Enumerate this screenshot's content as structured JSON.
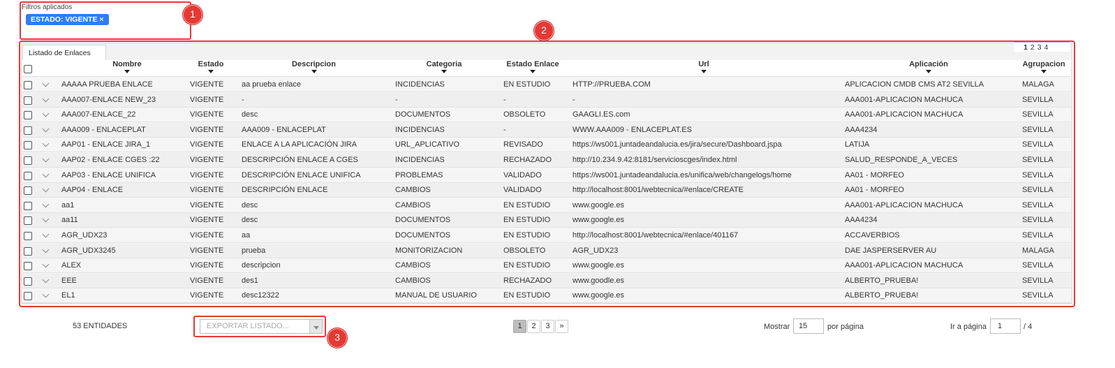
{
  "filters": {
    "title": "Filtros aplicados",
    "chip": "ESTADO: VIGENTE ×"
  },
  "callouts": [
    "1",
    "2",
    "3"
  ],
  "panel": {
    "tab": "Listado de Enlaces",
    "top_pages": [
      "1",
      "2",
      "3",
      "4"
    ],
    "top_current": "1"
  },
  "columns": [
    "Nombre",
    "Estado",
    "Descripcion",
    "Categoria",
    "Estado Enlace",
    "Url",
    "Aplicación",
    "Agrupacion"
  ],
  "rows": [
    [
      "AAAAA PRUEBA ENLACE",
      "VIGENTE",
      "aa prueba enlace",
      "INCIDENCIAS",
      "EN ESTUDIO",
      "HTTP://PRUEBA.COM",
      "APLICACION CMDB CMS AT2 SEVILLA",
      "MALAGA"
    ],
    [
      "AAA007-ENLACE NEW_23",
      "VIGENTE",
      "-",
      "-",
      "-",
      "-",
      "AAA001-APLICACION MACHUCA",
      "SEVILLA"
    ],
    [
      "AAA007-ENLACE_22",
      "VIGENTE",
      "desc",
      "DOCUMENTOS",
      "OBSOLETO",
      "GAAGLI.ES.com",
      "AAA001-APLICACION MACHUCA",
      "SEVILLA"
    ],
    [
      "AAA009 - ENLACEPLAT",
      "VIGENTE",
      "AAA009 - ENLACEPLAT",
      "INCIDENCIAS",
      "-",
      "WWW.AAA009 - ENLACEPLAT.ES",
      "AAA4234",
      "SEVILLA"
    ],
    [
      "AAP01 - ENLACE JIRA_1",
      "VIGENTE",
      "ENLACE A LA APLICACIÓN JIRA",
      "URL_APLICATIVO",
      "REVISADO",
      "https://ws001.juntadeandalucia.es/jira/secure/Dashboard.jspa",
      "LATIJA",
      "SEVILLA"
    ],
    [
      "AAP02 - ENLACE CGES :22",
      "VIGENTE",
      "DESCRIPCIÓN ENLACE A CGES",
      "INCIDENCIAS",
      "RECHAZADO",
      "http://10.234.9.42:8181/servicioscges/index.html",
      "SALUD_RESPONDE_A_VECES",
      "SEVILLA"
    ],
    [
      "AAP03 - ENLACE UNIFICA",
      "VIGENTE",
      "DESCRIPCIÓN ENLACE UNIFICA",
      "PROBLEMAS",
      "VALIDADO",
      "https://ws001.juntadeandalucia.es/unifica/web/changelogs/home",
      "AA01 - MORFEO",
      "SEVILLA"
    ],
    [
      "AAP04 - ENLACE",
      "VIGENTE",
      "DESCRIPCIÓN ENLACE",
      "CAMBIOS",
      "VALIDADO",
      "http://localhost:8001/webtecnica/#enlace/CREATE",
      "AA01 - MORFEO",
      "SEVILLA"
    ],
    [
      "aa1",
      "VIGENTE",
      "desc",
      "CAMBIOS",
      "EN ESTUDIO",
      "www.google.es",
      "AAA001-APLICACION MACHUCA",
      "SEVILLA"
    ],
    [
      "aa11",
      "VIGENTE",
      "desc",
      "DOCUMENTOS",
      "EN ESTUDIO",
      "www.google.es",
      "AAA4234",
      "SEVILLA"
    ],
    [
      "AGR_UDX23",
      "VIGENTE",
      "aa",
      "DOCUMENTOS",
      "EN ESTUDIO",
      "http://localhost:8001/webtecnica/#enlace/401167",
      "ACCAVERBIOS",
      "SEVILLA"
    ],
    [
      "AGR_UDX3245",
      "VIGENTE",
      "prueba",
      "MONITORIZACION",
      "OBSOLETO",
      "AGR_UDX23",
      "DAE JASPERSERVER AU",
      "MALAGA"
    ],
    [
      "ALEX",
      "VIGENTE",
      "descripcion",
      "CAMBIOS",
      "EN ESTUDIO",
      "www.google.es",
      "AAA001-APLICACION MACHUCA",
      "SEVILLA"
    ],
    [
      "EEE",
      "VIGENTE",
      "des1",
      "CAMBIOS",
      "RECHAZADO",
      "www.goodle.es",
      "ALBERTO_PRUEBA!",
      "SEVILLA"
    ],
    [
      "EL1",
      "VIGENTE",
      "desc12322",
      "MANUAL DE USUARIO",
      "EN ESTUDIO",
      "www.google.es",
      "ALBERTO_PRUEBA!",
      "SEVILLA"
    ]
  ],
  "footer": {
    "count": "53 ENTIDADES",
    "export_placeholder": "EXPORTAR LISTADO...",
    "pages": [
      "1",
      "2",
      "3",
      "»"
    ],
    "show_label": "Mostrar",
    "per_page": "15",
    "per_page_label": "por página",
    "goto_label": "Ir a página",
    "goto_value": "1",
    "goto_total": "/ 4"
  },
  "colors": {
    "accent": "#2f7cf6",
    "callout": "#e53935"
  }
}
